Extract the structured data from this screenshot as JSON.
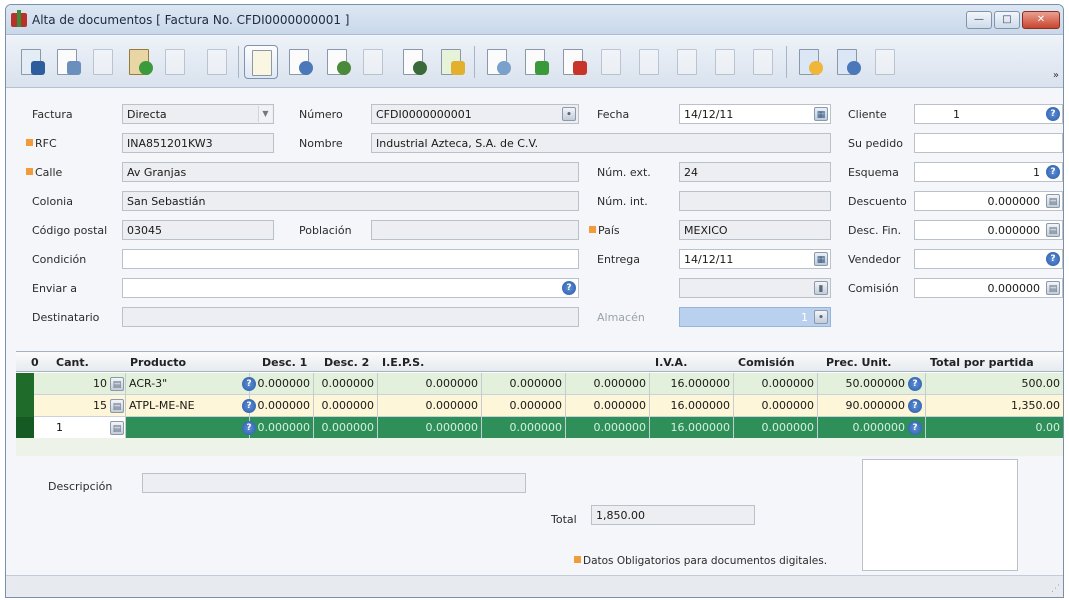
{
  "window": {
    "title": "Alta de documentos [ Factura No. CFDI0000000001 ]"
  },
  "header": {
    "factura_label": "Factura",
    "factura_value": "Directa",
    "numero_label": "Número",
    "numero_value": "CFDI0000000001",
    "fecha_label": "Fecha",
    "fecha_value": "14/12/11",
    "cliente_label": "Cliente",
    "cliente_value": "1",
    "rfc_label": "RFC",
    "rfc_value": "INA851201KW3",
    "nombre_label": "Nombre",
    "nombre_value": "Industrial Azteca, S.A. de C.V.",
    "supedido_label": "Su pedido",
    "supedido_value": "",
    "calle_label": "Calle",
    "calle_value": "Av Granjas",
    "numext_label": "Núm. ext.",
    "numext_value": "24",
    "esquema_label": "Esquema",
    "esquema_value": "1",
    "colonia_label": "Colonia",
    "colonia_value": "San Sebastián",
    "numint_label": "Núm. int.",
    "numint_value": "",
    "descuento_label": "Descuento",
    "descuento_value": "0.000000",
    "cp_label": "Código postal",
    "cp_value": "03045",
    "poblacion_label": "Población",
    "poblacion_value": "",
    "pais_label": "País",
    "pais_value": "MEXICO",
    "descfin_label": "Desc. Fin.",
    "descfin_value": "0.000000",
    "condicion_label": "Condición",
    "condicion_value": "",
    "entrega_label": "Entrega",
    "entrega_value": "14/12/11",
    "vendedor_label": "Vendedor",
    "vendedor_value": "",
    "enviar_label": "Enviar a",
    "enviar_value": "",
    "comision_label": "Comisión",
    "comision_value": "0.000000",
    "destinatario_label": "Destinatario",
    "destinatario_value": "",
    "almacen_label": "Almacén",
    "almacen_value": "1"
  },
  "grid": {
    "headers": [
      "0",
      "Cant.",
      "Producto",
      "Desc. 1",
      "Desc. 2",
      "I.E.P.S.",
      "I.V.A.",
      "Comisión",
      "Prec. Unit.",
      "Total por partida"
    ],
    "rows": [
      {
        "cant": "10",
        "producto": "ACR-3\"",
        "desc1": "0.000000",
        "desc2": "0.000000",
        "ieps": "0.000000",
        "extra1": "0.000000",
        "extra2": "0.000000",
        "iva": "16.000000",
        "comision": "0.000000",
        "precio": "50.000000",
        "total": "500.00"
      },
      {
        "cant": "15",
        "producto": "ATPL-ME-NE",
        "desc1": "0.000000",
        "desc2": "0.000000",
        "ieps": "0.000000",
        "extra1": "0.000000",
        "extra2": "0.000000",
        "iva": "16.000000",
        "comision": "0.000000",
        "precio": "90.000000",
        "total": "1,350.00"
      },
      {
        "cant": "1",
        "producto": "",
        "desc1": "0.000000",
        "desc2": "0.000000",
        "ieps": "0.000000",
        "extra1": "0.000000",
        "extra2": "0.000000",
        "iva": "16.000000",
        "comision": "0.000000",
        "precio": "0.000000",
        "total": "0.00"
      }
    ]
  },
  "footer": {
    "descripcion_label": "Descripción",
    "descripcion_value": "",
    "total_label": "Total",
    "total_value": "1,850.00",
    "legend_text": "Datos Obligatorios para documentos digitales."
  },
  "colors": {
    "required_marker": "#f29b3a",
    "row_green": "#e3f1dc",
    "row_yellow": "#fdf6d8",
    "row_active": "#2f8f58"
  }
}
